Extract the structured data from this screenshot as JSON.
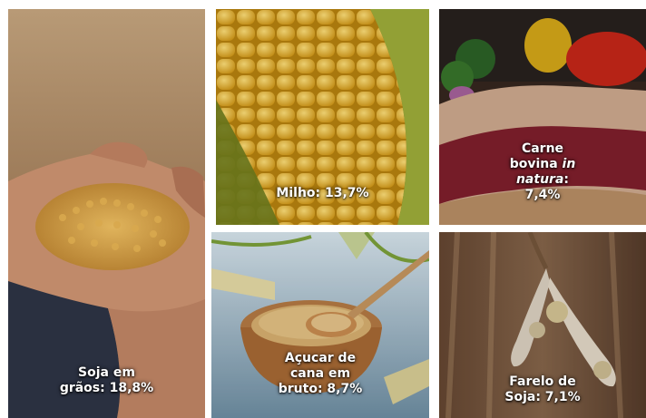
{
  "tiles": {
    "soja": {
      "line1": "Soja em",
      "line2": "grãos: 18,8%"
    },
    "milho": {
      "line1": "Milho: 13,7%"
    },
    "carne": {
      "line1": "Carne",
      "line2a": "bovina ",
      "line2b": "in",
      "line3a": "natura",
      "line3b": ":",
      "line4": "7,4%"
    },
    "acucar": {
      "line1": "Açucar de",
      "line2": "cana em",
      "line3": "bruto: 8,7%"
    },
    "farelo": {
      "line1": "Farelo de",
      "line2": "Soja: 7,1%"
    }
  }
}
